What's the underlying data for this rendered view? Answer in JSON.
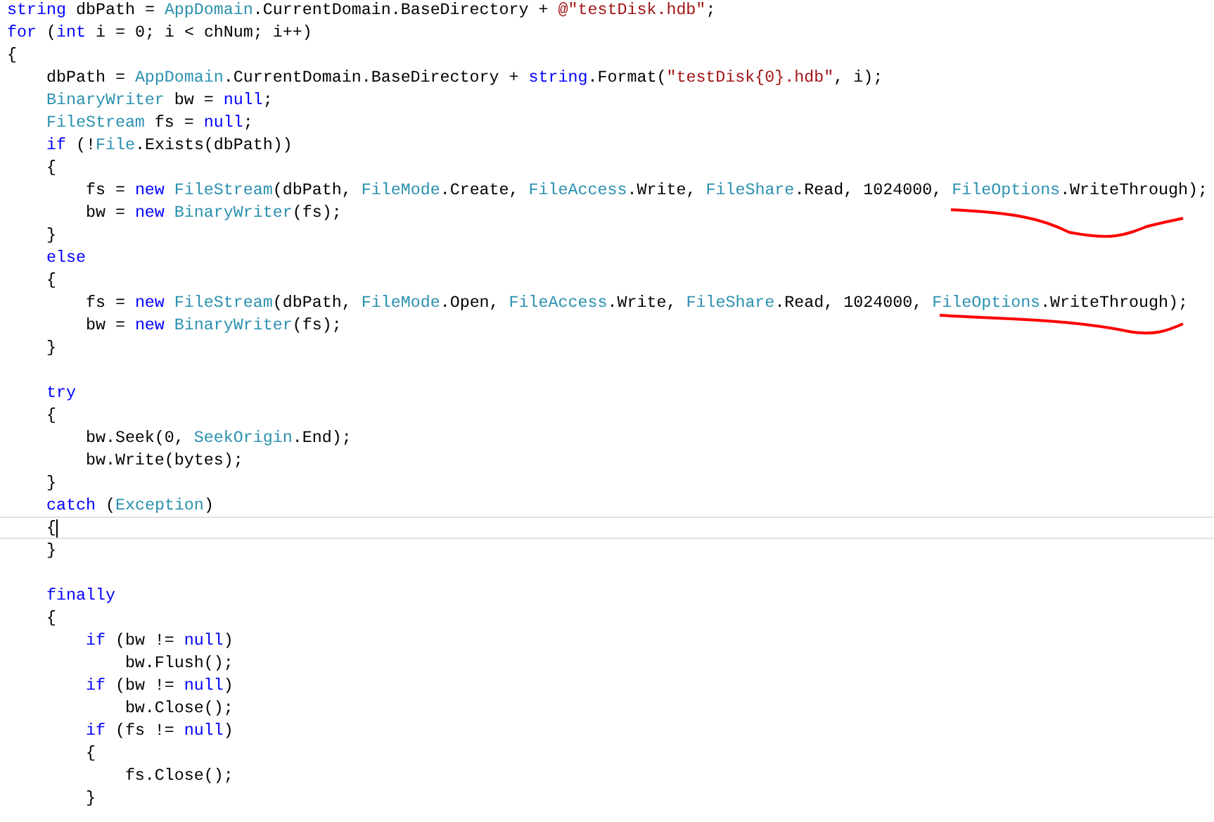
{
  "editor": {
    "lines": [
      {
        "current": false,
        "tokens": [
          {
            "kind": "keyword",
            "text": "string"
          },
          {
            "kind": "plain",
            "text": " dbPath = "
          },
          {
            "kind": "type",
            "text": "AppDomain"
          },
          {
            "kind": "plain",
            "text": ".CurrentDomain.BaseDirectory + "
          },
          {
            "kind": "string",
            "text": "@\"testDisk.hdb\""
          },
          {
            "kind": "plain",
            "text": ";"
          }
        ]
      },
      {
        "current": false,
        "tokens": [
          {
            "kind": "keyword",
            "text": "for"
          },
          {
            "kind": "plain",
            "text": " ("
          },
          {
            "kind": "keyword",
            "text": "int"
          },
          {
            "kind": "plain",
            "text": " i = 0; i < chNum; i++)"
          }
        ]
      },
      {
        "current": false,
        "tokens": [
          {
            "kind": "plain",
            "text": "{"
          }
        ]
      },
      {
        "current": false,
        "tokens": [
          {
            "kind": "plain",
            "text": "    dbPath = "
          },
          {
            "kind": "type",
            "text": "AppDomain"
          },
          {
            "kind": "plain",
            "text": ".CurrentDomain.BaseDirectory + "
          },
          {
            "kind": "keyword",
            "text": "string"
          },
          {
            "kind": "plain",
            "text": ".Format("
          },
          {
            "kind": "string",
            "text": "\"testDisk{0}.hdb\""
          },
          {
            "kind": "plain",
            "text": ", i);"
          }
        ]
      },
      {
        "current": false,
        "tokens": [
          {
            "kind": "type",
            "text": "    BinaryWriter"
          },
          {
            "kind": "plain",
            "text": " bw = "
          },
          {
            "kind": "keyword",
            "text": "null"
          },
          {
            "kind": "plain",
            "text": ";"
          }
        ]
      },
      {
        "current": false,
        "tokens": [
          {
            "kind": "type",
            "text": "    FileStream"
          },
          {
            "kind": "plain",
            "text": " fs = "
          },
          {
            "kind": "keyword",
            "text": "null"
          },
          {
            "kind": "plain",
            "text": ";"
          }
        ]
      },
      {
        "current": false,
        "tokens": [
          {
            "kind": "keyword",
            "text": "    if"
          },
          {
            "kind": "plain",
            "text": " (!"
          },
          {
            "kind": "type",
            "text": "File"
          },
          {
            "kind": "plain",
            "text": ".Exists(dbPath))"
          }
        ]
      },
      {
        "current": false,
        "tokens": [
          {
            "kind": "plain",
            "text": "    {"
          }
        ]
      },
      {
        "current": false,
        "tokens": [
          {
            "kind": "plain",
            "text": "        fs = "
          },
          {
            "kind": "keyword",
            "text": "new"
          },
          {
            "kind": "type",
            "text": " FileStream"
          },
          {
            "kind": "plain",
            "text": "(dbPath, "
          },
          {
            "kind": "type",
            "text": "FileMode"
          },
          {
            "kind": "plain",
            "text": ".Create, "
          },
          {
            "kind": "type",
            "text": "FileAccess"
          },
          {
            "kind": "plain",
            "text": ".Write, "
          },
          {
            "kind": "type",
            "text": "FileShare"
          },
          {
            "kind": "plain",
            "text": ".Read, 1024000, "
          },
          {
            "kind": "type",
            "text": "FileOptions"
          },
          {
            "kind": "plain",
            "text": ".WriteThrough);"
          }
        ]
      },
      {
        "current": false,
        "tokens": [
          {
            "kind": "plain",
            "text": "        bw = "
          },
          {
            "kind": "keyword",
            "text": "new"
          },
          {
            "kind": "type",
            "text": " BinaryWriter"
          },
          {
            "kind": "plain",
            "text": "(fs);"
          }
        ]
      },
      {
        "current": false,
        "tokens": [
          {
            "kind": "plain",
            "text": "    }"
          }
        ]
      },
      {
        "current": false,
        "tokens": [
          {
            "kind": "keyword",
            "text": "    else"
          }
        ]
      },
      {
        "current": false,
        "tokens": [
          {
            "kind": "plain",
            "text": "    {"
          }
        ]
      },
      {
        "current": false,
        "tokens": [
          {
            "kind": "plain",
            "text": "        fs = "
          },
          {
            "kind": "keyword",
            "text": "new"
          },
          {
            "kind": "type",
            "text": " FileStream"
          },
          {
            "kind": "plain",
            "text": "(dbPath, "
          },
          {
            "kind": "type",
            "text": "FileMode"
          },
          {
            "kind": "plain",
            "text": ".Open, "
          },
          {
            "kind": "type",
            "text": "FileAccess"
          },
          {
            "kind": "plain",
            "text": ".Write, "
          },
          {
            "kind": "type",
            "text": "FileShare"
          },
          {
            "kind": "plain",
            "text": ".Read, 1024000, "
          },
          {
            "kind": "type",
            "text": "FileOptions"
          },
          {
            "kind": "plain",
            "text": ".WriteThrough);"
          }
        ]
      },
      {
        "current": false,
        "tokens": [
          {
            "kind": "plain",
            "text": "        bw = "
          },
          {
            "kind": "keyword",
            "text": "new"
          },
          {
            "kind": "type",
            "text": " BinaryWriter"
          },
          {
            "kind": "plain",
            "text": "(fs);"
          }
        ]
      },
      {
        "current": false,
        "tokens": [
          {
            "kind": "plain",
            "text": "    }"
          }
        ]
      },
      {
        "current": false
      },
      {
        "current": false,
        "tokens": [
          {
            "kind": "keyword",
            "text": "    try"
          }
        ]
      },
      {
        "current": false,
        "tokens": [
          {
            "kind": "plain",
            "text": "    {"
          }
        ]
      },
      {
        "current": false,
        "tokens": [
          {
            "kind": "plain",
            "text": "        bw.Seek(0, "
          },
          {
            "kind": "type",
            "text": "SeekOrigin"
          },
          {
            "kind": "plain",
            "text": ".End);"
          }
        ]
      },
      {
        "current": false,
        "tokens": [
          {
            "kind": "plain",
            "text": "        bw.Write(bytes);"
          }
        ]
      },
      {
        "current": false,
        "tokens": [
          {
            "kind": "plain",
            "text": "    }"
          }
        ]
      },
      {
        "current": false,
        "tokens": [
          {
            "kind": "keyword",
            "text": "    catch"
          },
          {
            "kind": "plain",
            "text": " ("
          },
          {
            "kind": "type",
            "text": "Exception"
          },
          {
            "kind": "plain",
            "text": ")"
          }
        ]
      },
      {
        "current": true,
        "tokens": [
          {
            "kind": "plain",
            "text": "    {"
          }
        ]
      },
      {
        "current": false,
        "tokens": [
          {
            "kind": "plain",
            "text": "    }"
          }
        ]
      },
      {
        "current": false
      },
      {
        "current": false,
        "tokens": [
          {
            "kind": "keyword",
            "text": "    finally"
          }
        ]
      },
      {
        "current": false,
        "tokens": [
          {
            "kind": "plain",
            "text": "    {"
          }
        ]
      },
      {
        "current": false,
        "tokens": [
          {
            "kind": "keyword",
            "text": "        if"
          },
          {
            "kind": "plain",
            "text": " (bw != "
          },
          {
            "kind": "keyword",
            "text": "null"
          },
          {
            "kind": "plain",
            "text": ")"
          }
        ]
      },
      {
        "current": false,
        "tokens": [
          {
            "kind": "plain",
            "text": "            bw.Flush();"
          }
        ]
      },
      {
        "current": false,
        "tokens": [
          {
            "kind": "keyword",
            "text": "        if"
          },
          {
            "kind": "plain",
            "text": " (bw != "
          },
          {
            "kind": "keyword",
            "text": "null"
          },
          {
            "kind": "plain",
            "text": ")"
          }
        ]
      },
      {
        "current": false,
        "tokens": [
          {
            "kind": "plain",
            "text": "            bw.Close();"
          }
        ]
      },
      {
        "current": false,
        "tokens": [
          {
            "kind": "keyword",
            "text": "        if"
          },
          {
            "kind": "plain",
            "text": " (fs != "
          },
          {
            "kind": "keyword",
            "text": "null"
          },
          {
            "kind": "plain",
            "text": ")"
          }
        ]
      },
      {
        "current": false,
        "tokens": [
          {
            "kind": "plain",
            "text": "        {"
          }
        ]
      },
      {
        "current": false,
        "tokens": [
          {
            "kind": "plain",
            "text": "            fs.Close();"
          }
        ]
      },
      {
        "current": false,
        "tokens": [
          {
            "kind": "plain",
            "text": "        }"
          }
        ]
      }
    ]
  }
}
